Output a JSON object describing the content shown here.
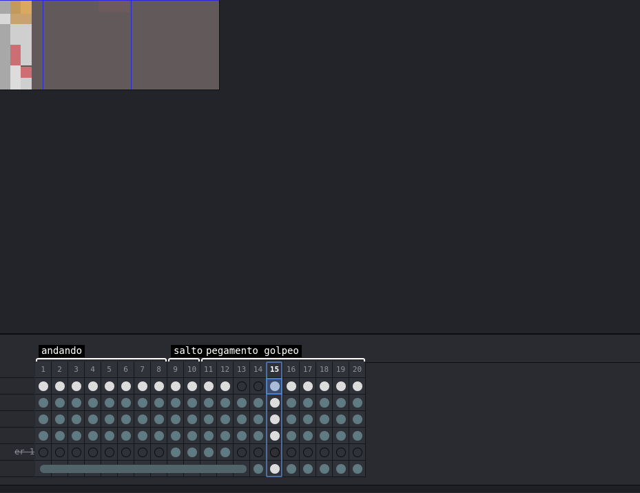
{
  "canvas": {
    "background": "#625a5a",
    "grid_color": "#2a2ad8"
  },
  "tags": [
    {
      "name": "andando",
      "from": 1,
      "to": 8
    },
    {
      "name": "salto",
      "from": 9,
      "to": 10
    },
    {
      "name": "pegamento golpeo",
      "from": 11,
      "to": 20
    }
  ],
  "frames": [
    "1",
    "2",
    "3",
    "4",
    "5",
    "6",
    "7",
    "8",
    "9",
    "10",
    "11",
    "12",
    "13",
    "14",
    "15",
    "16",
    "17",
    "18",
    "19",
    "20"
  ],
  "current_frame": 15,
  "layers": [
    {
      "name": "",
      "cels": [
        "f",
        "f",
        "f",
        "f",
        "f",
        "f",
        "f",
        "f",
        "f",
        "f",
        "f",
        "f",
        "e",
        "e",
        "f",
        "f",
        "f",
        "f",
        "f",
        "f"
      ]
    },
    {
      "name": "",
      "cels": [
        "l",
        "l",
        "l",
        "l",
        "l",
        "l",
        "l",
        "l",
        "l",
        "l",
        "l",
        "l",
        "l",
        "l",
        "f",
        "l",
        "l",
        "l",
        "l",
        "l"
      ]
    },
    {
      "name": "",
      "cels": [
        "l",
        "l",
        "l",
        "l",
        "l",
        "l",
        "l",
        "l",
        "l",
        "l",
        "l",
        "l",
        "l",
        "l",
        "f",
        "l",
        "l",
        "l",
        "l",
        "l"
      ]
    },
    {
      "name": "",
      "cels": [
        "l",
        "l",
        "l",
        "l",
        "l",
        "l",
        "l",
        "l",
        "l",
        "l",
        "l",
        "l",
        "l",
        "l",
        "f",
        "l",
        "l",
        "l",
        "l",
        "l"
      ]
    },
    {
      "name": "er 1",
      "cels": [
        "e",
        "e",
        "e",
        "e",
        "e",
        "e",
        "e",
        "e",
        "l",
        "l",
        "l",
        "l",
        "e",
        "e",
        "E",
        "e",
        "e",
        "e",
        "e",
        "e"
      ]
    },
    {
      "name": "",
      "cels": [
        "-",
        "-",
        "-",
        "-",
        "-",
        "-",
        "-",
        "-",
        "-",
        "-",
        "-",
        "-",
        "-",
        "l",
        "f",
        "l",
        "l",
        "l",
        "l",
        "l"
      ]
    }
  ]
}
